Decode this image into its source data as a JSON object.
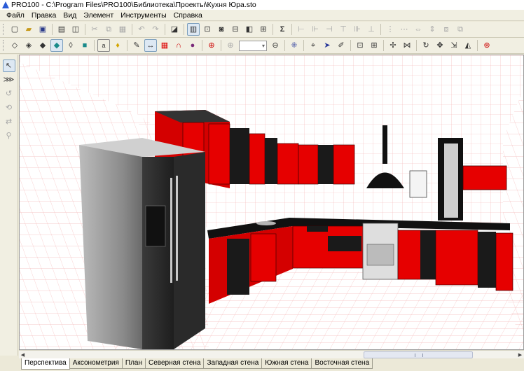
{
  "window": {
    "title": "PRO100 - C:\\Program Files\\PRO100\\Библиотека\\Проекты\\Кухня Юра.sto"
  },
  "menu": [
    "Файл",
    "Правка",
    "Вид",
    "Элемент",
    "Инструменты",
    "Справка"
  ],
  "toolbar1": [
    "new-icon",
    "open-icon",
    "save-icon",
    "print-icon",
    "preview-icon",
    "cut-icon",
    "copy-icon",
    "paste-icon",
    "undo-icon",
    "redo-icon",
    "properties-icon",
    "view-icon",
    "zoom-window-icon",
    "camera-icon",
    "dimensions-icon",
    "report-icon",
    "sum-icon",
    "align-icon",
    "align-icon",
    "align-icon",
    "align-icon",
    "align-icon",
    "align-icon",
    "align-icon",
    "align-icon",
    "align-icon",
    "align-icon",
    "align-icon"
  ],
  "toolbar2": [
    "wireframe-icon",
    "hidden-line-icon",
    "shaded-icon",
    "solid-icon",
    "texture-icon",
    "perspective-icon",
    "text-icon",
    "light-icon",
    "materials-icon",
    "measure-icon",
    "grid-icon",
    "magnet-icon",
    "target-icon",
    "zoom-in-icon",
    "zoom-out-icon",
    "snap-icon",
    "select-icon",
    "edit-icon",
    "transform-icon",
    "move-icon",
    "rotate-icon",
    "mirror-icon",
    "scale-icon",
    "stretch-icon",
    "help-icon"
  ],
  "zoom": {
    "value": ""
  },
  "left_tools": [
    "select-icon",
    "walls-icon",
    "rotate-view-icon",
    "orbit-icon",
    "pan-icon",
    "zoom-icon"
  ],
  "tabs": [
    "Перспектива",
    "Аксонометрия",
    "План",
    "Северная стена",
    "Западная стена",
    "Южная стена",
    "Восточная стена"
  ],
  "active_tab": "Перспектива",
  "scene": {
    "colors": {
      "cabinet_red": "#e60000",
      "cabinet_black": "#1a1a1a",
      "fridge": "#2c2c2c",
      "grid": "#f2a8a8",
      "countertop": "#111111"
    },
    "objects": [
      "refrigerator",
      "upper-cabinets",
      "lower-cabinets",
      "range-hood",
      "stove",
      "sink",
      "water-heater",
      "window",
      "wall-shelf"
    ]
  }
}
